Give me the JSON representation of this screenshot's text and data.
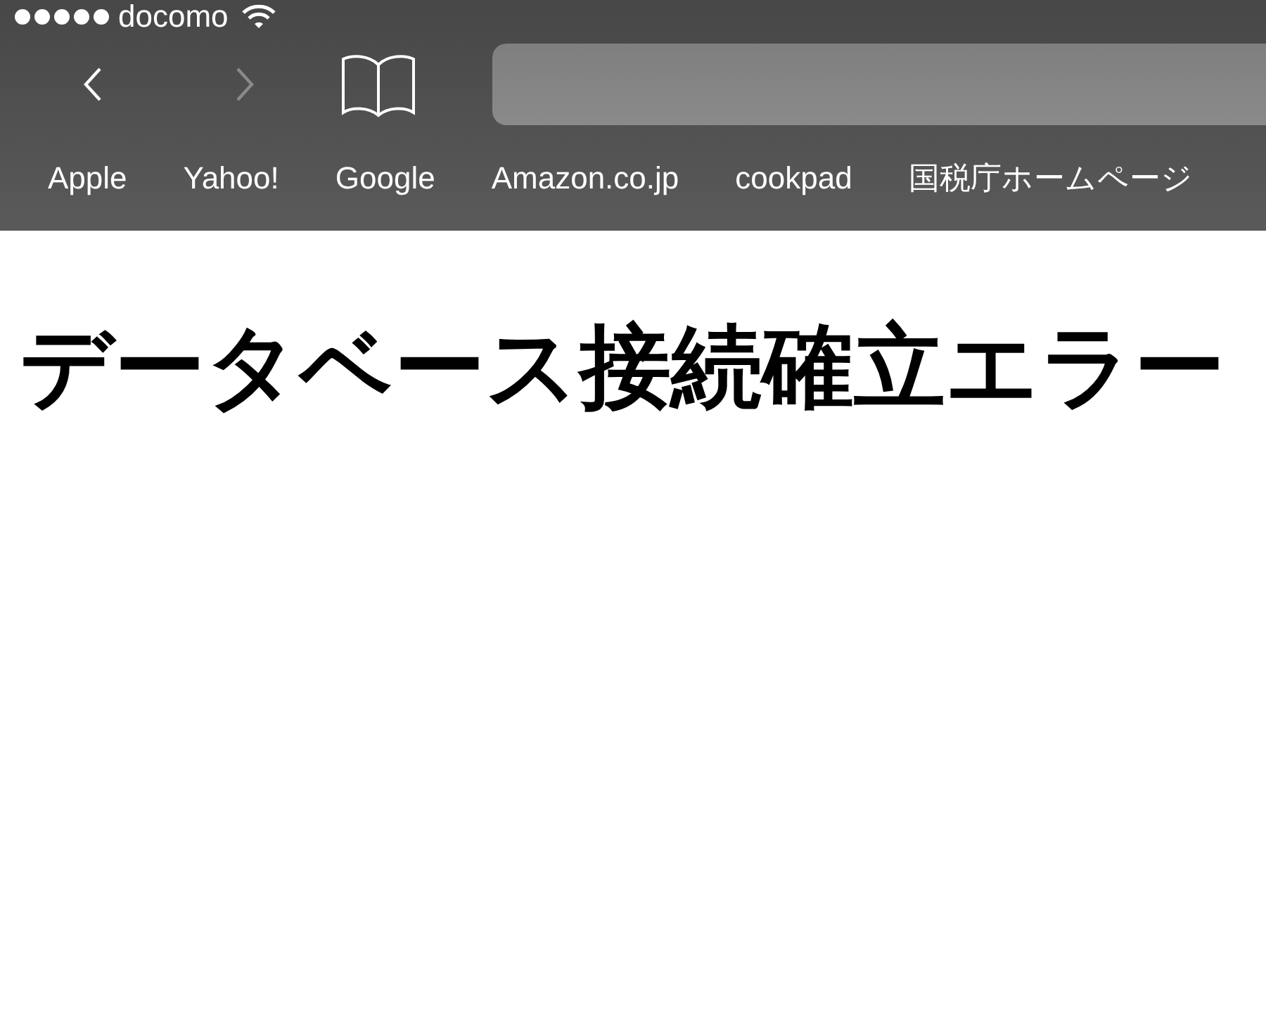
{
  "status_bar": {
    "carrier": "docomo"
  },
  "toolbar": {
    "nav": [
      {
        "kind": "back",
        "disabled": false
      },
      {
        "kind": "forward",
        "disabled": true
      }
    ]
  },
  "favorites": [
    {
      "label": "Apple"
    },
    {
      "label": "Yahoo!"
    },
    {
      "label": "Google"
    },
    {
      "label": "Amazon.co.jp"
    },
    {
      "label": "cookpad"
    },
    {
      "label": "国税庁ホームページ"
    }
  ],
  "page": {
    "heading": "データベース接続確立エラー"
  }
}
